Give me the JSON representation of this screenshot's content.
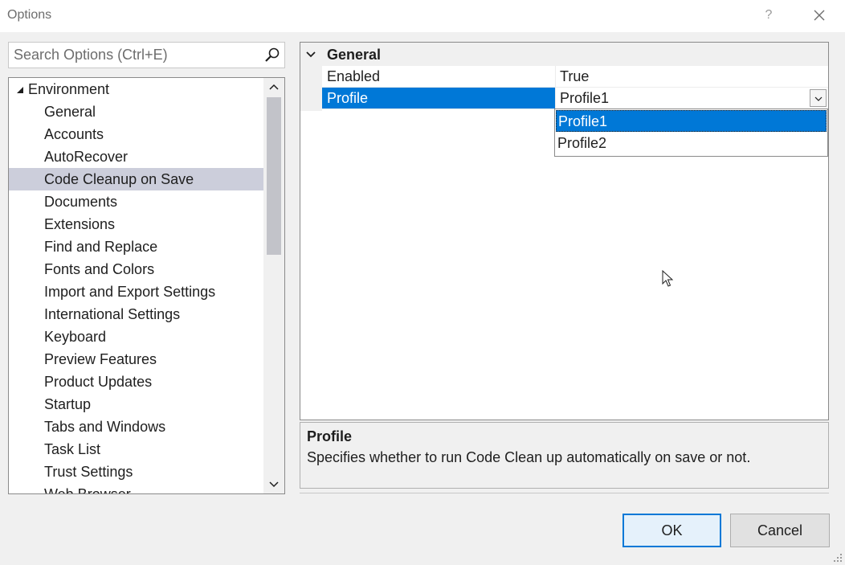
{
  "window": {
    "title": "Options",
    "help_label": "?"
  },
  "search": {
    "placeholder": "Search Options (Ctrl+E)"
  },
  "tree": {
    "root_label": "Environment",
    "items": [
      {
        "label": "General",
        "selected": false
      },
      {
        "label": "Accounts",
        "selected": false
      },
      {
        "label": "AutoRecover",
        "selected": false
      },
      {
        "label": "Code Cleanup on Save",
        "selected": true
      },
      {
        "label": "Documents",
        "selected": false
      },
      {
        "label": "Extensions",
        "selected": false
      },
      {
        "label": "Find and Replace",
        "selected": false
      },
      {
        "label": "Fonts and Colors",
        "selected": false
      },
      {
        "label": "Import and Export Settings",
        "selected": false
      },
      {
        "label": "International Settings",
        "selected": false
      },
      {
        "label": "Keyboard",
        "selected": false
      },
      {
        "label": "Preview Features",
        "selected": false
      },
      {
        "label": "Product Updates",
        "selected": false
      },
      {
        "label": "Startup",
        "selected": false
      },
      {
        "label": "Tabs and Windows",
        "selected": false
      },
      {
        "label": "Task List",
        "selected": false
      },
      {
        "label": "Trust Settings",
        "selected": false
      },
      {
        "label": "Web Browser",
        "selected": false
      }
    ]
  },
  "grid": {
    "category": "General",
    "properties": [
      {
        "name": "Enabled",
        "value": "True"
      },
      {
        "name": "Profile",
        "value": "Profile1"
      }
    ],
    "dropdown_options": [
      "Profile1",
      "Profile2"
    ]
  },
  "description": {
    "title": "Profile",
    "text": "Specifies whether to run Code Clean up automatically on save or not."
  },
  "buttons": {
    "ok": "OK",
    "cancel": "Cancel"
  },
  "colors": {
    "selection": "#0078d7",
    "tree_selection": "#cccedb"
  }
}
